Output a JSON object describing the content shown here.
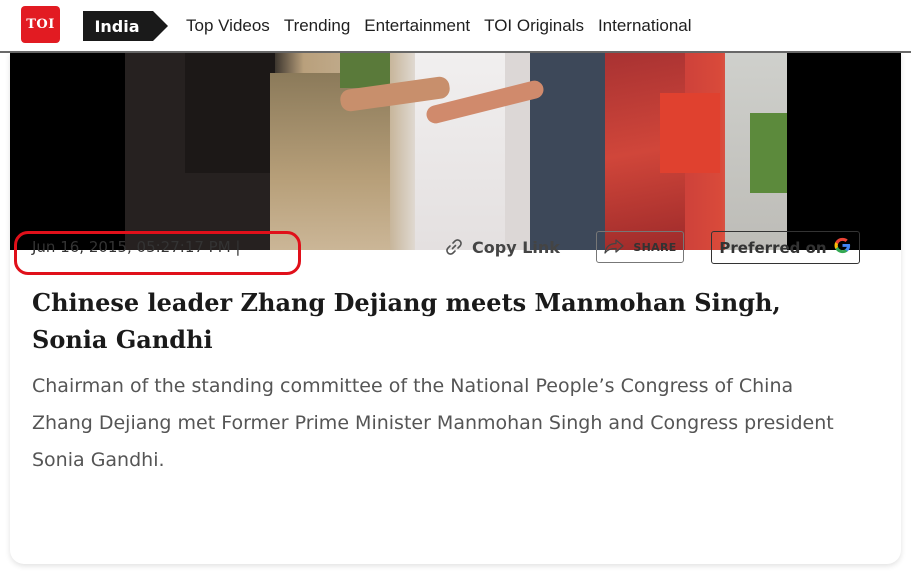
{
  "nav": {
    "logo_text": "TOI",
    "section": "India",
    "links": [
      "Top Videos",
      "Trending",
      "Entertainment",
      "TOI Originals",
      "International"
    ]
  },
  "article": {
    "timestamp": "Jun 16, 2015, 05:27:17 PM |",
    "copy_link_label": "Copy Link",
    "share_label": "SHARE",
    "preferred_label": "Preferred on",
    "headline": "Chinese leader Zhang Dejiang meets Manmohan Singh, Sonia Gandhi",
    "summary": "Chairman of the standing committee of the National People’s Congress of China Zhang Dejiang met Former Prime Minister Manmohan Singh and Congress president Sonia Gandhi."
  },
  "colors": {
    "brand_red": "#e21b22",
    "highlight_red": "#e0101a"
  },
  "icons": [
    "link-icon",
    "share-arrow-icon",
    "google-g-icon"
  ]
}
